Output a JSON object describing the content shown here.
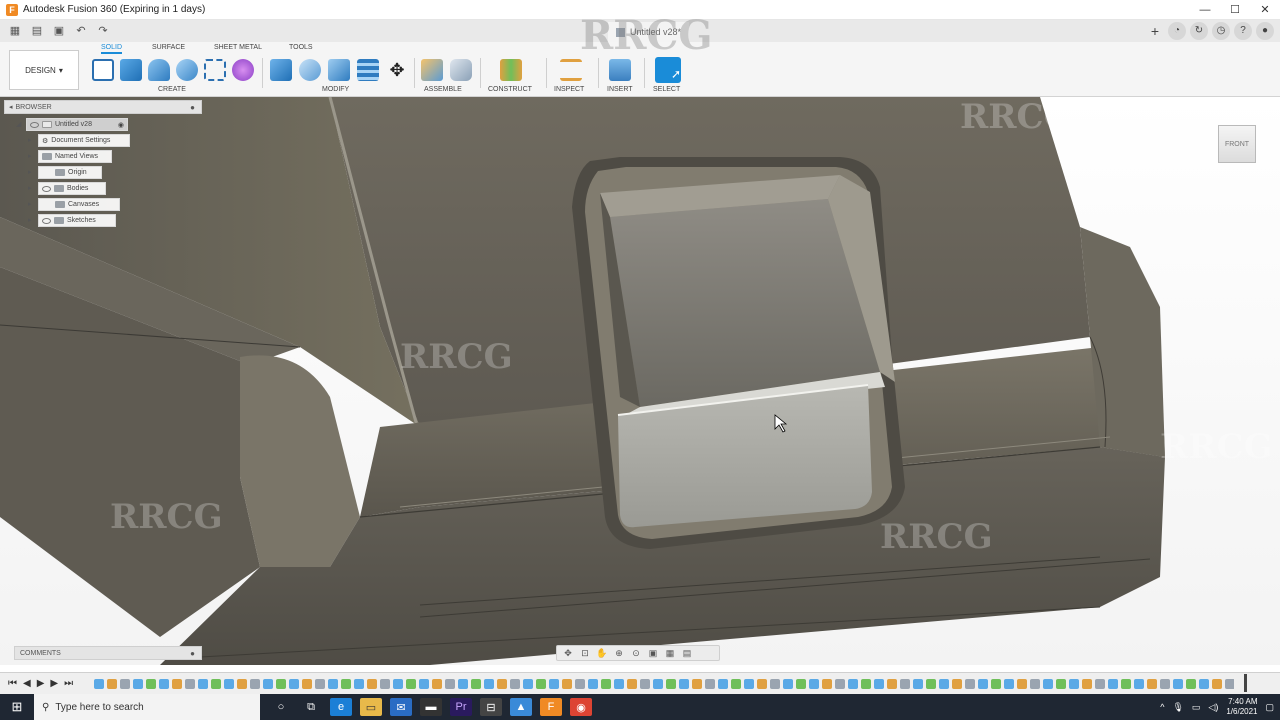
{
  "window": {
    "title": "Autodesk Fusion 360 (Expiring in 1 days)",
    "controls": [
      "—",
      "☐",
      "✕"
    ]
  },
  "doc_tab": {
    "label": "Untitled v28*"
  },
  "toolbar": {
    "workspace": "DESIGN",
    "tabs": [
      "SOLID",
      "SURFACE",
      "SHEET METAL",
      "TOOLS"
    ],
    "groups": [
      "CREATE",
      "MODIFY",
      "ASSEMBLE",
      "CONSTRUCT",
      "INSPECT",
      "INSERT",
      "SELECT"
    ]
  },
  "browser": {
    "header": "BROWSER",
    "root": "Untitled v28",
    "items": [
      "Document Settings",
      "Named Views",
      "Origin",
      "Bodies",
      "Canvases",
      "Sketches"
    ]
  },
  "comments": {
    "header": "COMMENTS"
  },
  "viewcube": {
    "face": "FRONT"
  },
  "watermark": {
    "text": "RRCG"
  },
  "taskbar": {
    "search_placeholder": "Type here to search",
    "time": "7:40 AM",
    "date": "1/6/2021"
  },
  "colors": {
    "accent": "#1a8cd8",
    "model": "#6f6a5f",
    "taskbar": "#1f2733"
  }
}
